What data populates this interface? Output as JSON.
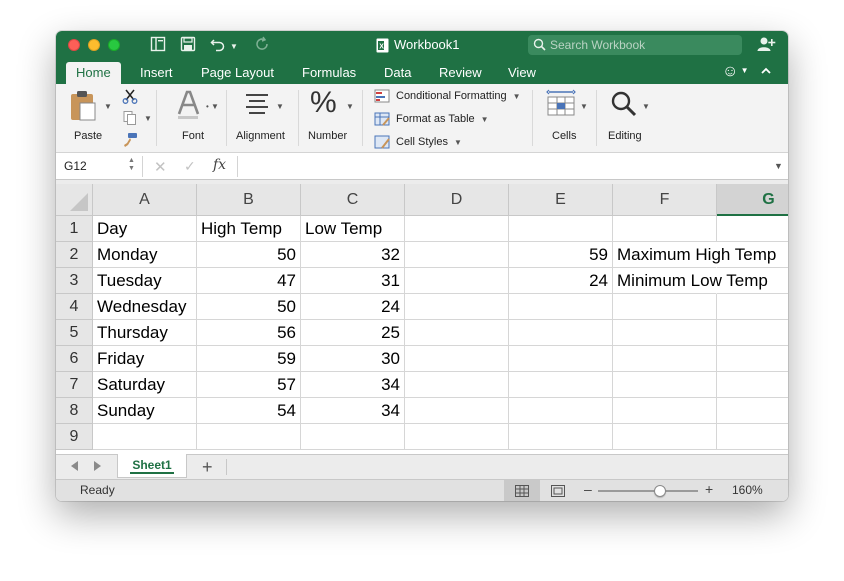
{
  "window": {
    "title": "Workbook1"
  },
  "search": {
    "placeholder": "Search Workbook"
  },
  "tabs": [
    {
      "label": "Home",
      "active": true
    },
    {
      "label": "Insert"
    },
    {
      "label": "Page Layout"
    },
    {
      "label": "Formulas"
    },
    {
      "label": "Data"
    },
    {
      "label": "Review"
    },
    {
      "label": "View"
    }
  ],
  "ribbon": {
    "paste_label": "Paste",
    "font_label": "Font",
    "alignment_label": "Alignment",
    "number_label": "Number",
    "conditional_formatting_label": "Conditional Formatting",
    "format_as_table_label": "Format as Table",
    "cell_styles_label": "Cell Styles",
    "cells_label": "Cells",
    "editing_label": "Editing"
  },
  "formula_bar": {
    "name_box": "G12",
    "fx_symbol": "fx",
    "formula": ""
  },
  "columns": [
    "A",
    "B",
    "C",
    "D",
    "E",
    "F",
    "G"
  ],
  "selected_column": "G",
  "rows": [
    "1",
    "2",
    "3",
    "4",
    "5",
    "6",
    "7",
    "8",
    "9"
  ],
  "cells": {
    "A1": "Day",
    "B1": "High Temp",
    "C1": "Low Temp",
    "A2": "Monday",
    "B2": "50",
    "C2": "32",
    "E2": "59",
    "F2": "Maximum High Temp",
    "A3": "Tuesday",
    "B3": "47",
    "C3": "31",
    "E3": "24",
    "F3": "Minimum Low Temp",
    "A4": "Wednesday",
    "B4": "50",
    "C4": "24",
    "A5": "Thursday",
    "B5": "56",
    "C5": "25",
    "A6": "Friday",
    "B6": "59",
    "C6": "30",
    "A7": "Saturday",
    "B7": "57",
    "C7": "34",
    "A8": "Sunday",
    "B8": "54",
    "C8": "34"
  },
  "sheets": {
    "active": "Sheet1",
    "add_symbol": "+"
  },
  "status": {
    "state": "Ready",
    "zoom": "160%",
    "zoom_level": 0.62
  },
  "colors": {
    "accent": "#1f7144",
    "ribbon": "#f3f3f3"
  }
}
